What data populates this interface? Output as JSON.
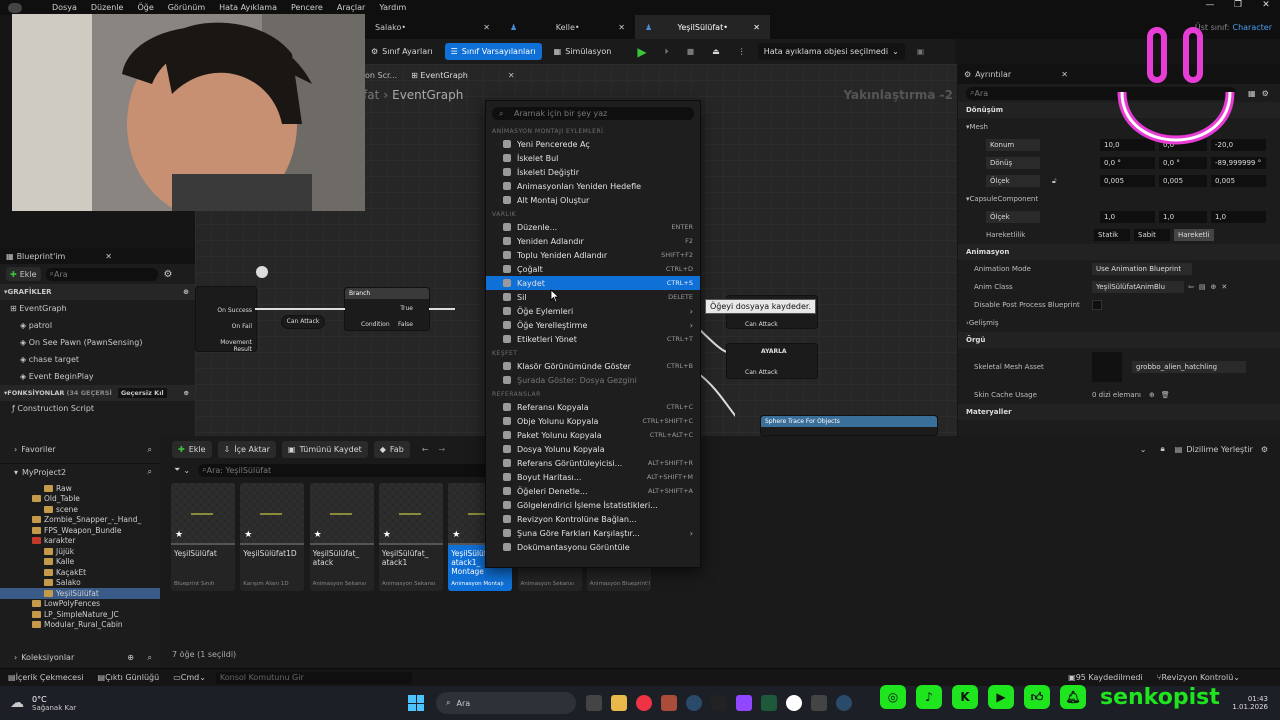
{
  "menubar": {
    "items": [
      "Dosya",
      "Düzenle",
      "Öğe",
      "Görünüm",
      "Hata Ayıklama",
      "Pencere",
      "Araçlar",
      "Yardım"
    ],
    "parent_class_label": "Üst sınıf:",
    "parent_class_value": "Character"
  },
  "doc_tabs": [
    {
      "label": "Salako•"
    },
    {
      "label": "Kelle•"
    },
    {
      "label": "YeşilSülüfat•"
    }
  ],
  "toolbar": {
    "class_settings": "Sınıf Ayarları",
    "class_defaults": "Sınıf Varsayılanları",
    "simulation": "Simülasyon",
    "debug_object": "Hata ayıklama objesi seçilmedi"
  },
  "graph": {
    "tabs": [
      "on Scr...",
      "EventGraph"
    ],
    "breadcrumb_prefix": "fat",
    "breadcrumb": "EventGraph",
    "zoom": "Yakınlaştırma -2",
    "nodes": {
      "branch_title": "Branch",
      "branch_condition": "Condition",
      "branch_true": "True",
      "branch_false": "False",
      "on_success": "On Success",
      "on_fail": "On Fail",
      "movement_result": "Movement Result",
      "can_attack": "Can Attack",
      "ayarla": "AYARLA",
      "can_attack2": "Can Attack",
      "can_attack3": "Can Attack",
      "sphere_trace": "Sphere Trace For Objects"
    }
  },
  "blueprint_panel": {
    "title": "Blueprint'im",
    "add": "Ekle",
    "search_placeholder": "Ara",
    "graphs_header": "GRAFİKLER",
    "event_graph": "EventGraph",
    "events": [
      "patrol",
      "On See Pawn (PawnSensing)",
      "chase target",
      "Event BeginPlay"
    ],
    "functions_header": "FONKSİYONLAR",
    "functions_count": "(34 GEÇERSİ",
    "filter": "Geçersiz Kıl",
    "construction": "Construction Script"
  },
  "context_menu": {
    "search_placeholder": "Aramak için bir şey yaz",
    "sections": [
      {
        "title": "ANİMASYON MONTAJI EYLEMLERİ",
        "items": [
          {
            "label": "Yeni Pencerede Aç",
            "shortcut": ""
          },
          {
            "label": "İskelet Bul",
            "shortcut": ""
          },
          {
            "label": "İskeleti Değiştir",
            "shortcut": ""
          },
          {
            "label": "Animasyonları Yeniden Hedefle",
            "shortcut": ""
          },
          {
            "label": "Alt Montaj Oluştur",
            "shortcut": ""
          }
        ]
      },
      {
        "title": "VARLIK",
        "items": [
          {
            "label": "Düzenle...",
            "shortcut": "ENTER"
          },
          {
            "label": "Yeniden Adlandır",
            "shortcut": "F2"
          },
          {
            "label": "Toplu Yeniden Adlandır",
            "shortcut": "SHIFT+F2"
          },
          {
            "label": "Çoğalt",
            "shortcut": "CTRL+D"
          },
          {
            "label": "Kaydet",
            "shortcut": "CTRL+S"
          },
          {
            "label": "Sil",
            "shortcut": "DELETE"
          },
          {
            "label": "Öğe Eylemleri",
            "shortcut": ""
          },
          {
            "label": "Öğe Yerelleştirme",
            "shortcut": ""
          },
          {
            "label": "Etiketleri Yönet",
            "shortcut": "CTRL+T"
          }
        ]
      },
      {
        "title": "KEŞFET",
        "items": [
          {
            "label": "Klasör Görünümünde Göster",
            "shortcut": "CTRL+B"
          },
          {
            "label": "Şurada Göster: Dosya Gezgini",
            "shortcut": ""
          }
        ]
      },
      {
        "title": "REFERANSLAR",
        "items": [
          {
            "label": "Referansı Kopyala",
            "shortcut": "CTRL+C"
          },
          {
            "label": "Obje Yolunu Kopyala",
            "shortcut": "CTRL+SHIFT+C"
          },
          {
            "label": "Paket Yolunu Kopyala",
            "shortcut": "CTRL+ALT+C"
          },
          {
            "label": "Dosya Yolunu Kopyala",
            "shortcut": ""
          },
          {
            "label": "Referans Görüntüleyicisi...",
            "shortcut": "ALT+SHIFT+R"
          },
          {
            "label": "Boyut Haritası...",
            "shortcut": "ALT+SHIFT+M"
          },
          {
            "label": "Öğeleri Denetle...",
            "shortcut": "ALT+SHIFT+A"
          },
          {
            "label": "Gölgelendirici İşleme İstatistikleri...",
            "shortcut": ""
          },
          {
            "label": "Revizyon Kontrolüne Bağlan...",
            "shortcut": ""
          },
          {
            "label": "Şuna Göre Farkları Karşılaştır...",
            "shortcut": ""
          },
          {
            "label": "Dokümantasyonu Görüntüle",
            "shortcut": ""
          }
        ]
      }
    ],
    "tooltip": "Öğeyi dosyaya kaydeder."
  },
  "details": {
    "title": "Ayrıntılar",
    "search_placeholder": "Ara",
    "transform": "Dönüşüm",
    "mesh": "Mesh",
    "location": "Konum",
    "rotation": "Dönüş",
    "scale": "Ölçek",
    "loc_vals": [
      "10,0",
      "0,0",
      "-20,0"
    ],
    "rot_vals": [
      "0,0 °",
      "0,0 °",
      "-89,999999 °"
    ],
    "scale_vals": [
      "0,005",
      "0,005",
      "0,005"
    ],
    "capsule": "CapsuleComponent",
    "capsule_scale": [
      "1,0",
      "1,0",
      "1,0"
    ],
    "mobility": "Hareketlilik",
    "mobility_opts": [
      "Statik",
      "Sabit",
      "Hareketli"
    ],
    "animation": "Animasyon",
    "anim_mode_label": "Animation Mode",
    "anim_mode_value": "Use Animation Blueprint",
    "anim_class_label": "Anim Class",
    "anim_class_value": "YeşilSülüfatAnimBlu",
    "disable_pp": "Disable Post Process Blueprint",
    "advanced": "Gelişmiş",
    "mesh_section": "Örgü",
    "skeletal_mesh_label": "Skeletal Mesh Asset",
    "skeletal_mesh_value": "grobbo_alien_hatchling",
    "skin_cache_label": "Skin Cache Usage",
    "skin_cache_value": "0 dizi elemanı",
    "materials": "Materyaller"
  },
  "content_browser": {
    "favorites": "Favoriler",
    "project": "MyProject2",
    "collections": "Koleksiyonlar",
    "tree": [
      {
        "label": "Raw",
        "depth": 3,
        "sel": false
      },
      {
        "label": "Old_Table",
        "depth": 2,
        "sel": false
      },
      {
        "label": "scene",
        "depth": 3,
        "sel": false
      },
      {
        "label": "Zombie_Snapper_-_Hand_",
        "depth": 2,
        "sel": false
      },
      {
        "label": "FPS_Weapon_Bundle",
        "depth": 2,
        "sel": false
      },
      {
        "label": "karakter",
        "depth": 2,
        "sel": false
      },
      {
        "label": "Jüjük",
        "depth": 3,
        "sel": false
      },
      {
        "label": "Kalle",
        "depth": 3,
        "sel": false
      },
      {
        "label": "KaçakEt",
        "depth": 3,
        "sel": false
      },
      {
        "label": "Salako",
        "depth": 3,
        "sel": false
      },
      {
        "label": "YeşilSülüfat",
        "depth": 3,
        "sel": true
      },
      {
        "label": "LowPolyFences",
        "depth": 2,
        "sel": false
      },
      {
        "label": "LP_SimpleNature_JC",
        "depth": 2,
        "sel": false
      },
      {
        "label": "Modular_Rural_Cabin",
        "depth": 2,
        "sel": false
      }
    ],
    "add": "Ekle",
    "import": "İçe Aktar",
    "save_all": "Tümünü Kaydet",
    "fab": "Fab",
    "search_placeholder": "Ara: YeşilSülüfat",
    "dock": "Dizilime Yerleştir",
    "assets": [
      {
        "name": "YeşilSülüfat",
        "type": "Blueprint Sınıfı",
        "sel": false
      },
      {
        "name": "YeşilSülüfat1D",
        "type": "Karışım Alanı 1D",
        "sel": false
      },
      {
        "name": "YeşilSülüfat_ atack",
        "type": "Animasyon Sekansı",
        "sel": false
      },
      {
        "name": "YeşilSülüfat_ atack1",
        "type": "Animasyon Sekansı",
        "sel": false
      },
      {
        "name": "YeşilSülüfat_ atack1_ Montage",
        "type": "Animasyon Montajı",
        "sel": true
      },
      {
        "name": "",
        "type": "Animasyon Sekansı",
        "sel": false
      },
      {
        "name": "",
        "type": "Animasyon Blueprint'i",
        "sel": false
      }
    ],
    "count": "7 öğe (1 seçildi)"
  },
  "statusbar": {
    "content_drawer": "İçerik Çekmecesi",
    "output_log": "Çıktı Günlüğü",
    "cmd": "Cmd",
    "console_placeholder": "Konsol Komutunu Gir",
    "saved": "95 Kaydedilmedi",
    "revision": "Revizyon Kontrolü"
  },
  "taskbar": {
    "temp": "0°C",
    "weather": "Sağanak Kar",
    "search": "Ara",
    "time": "01:43",
    "date": "1.01.2026"
  },
  "overlay": {
    "brand": "senkopist"
  },
  "colors": {
    "accent": "#0f70d7",
    "brand_green": "#1ee51e",
    "smiley": "#e83cd6"
  }
}
